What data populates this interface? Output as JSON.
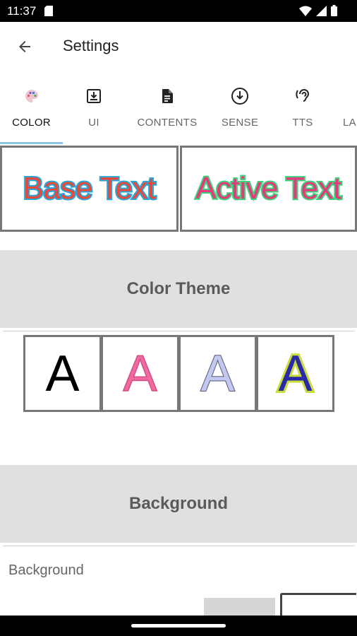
{
  "status_bar": {
    "time": "11:37"
  },
  "app_bar": {
    "title": "Settings",
    "back_icon": "arrow-back-icon"
  },
  "tabs": [
    {
      "label": "COLOR",
      "icon": "palette-icon",
      "active": true
    },
    {
      "label": "UI",
      "icon": "download-box-icon",
      "active": false
    },
    {
      "label": "CONTENTS",
      "icon": "document-icon",
      "active": false
    },
    {
      "label": "SENSE",
      "icon": "circle-arrow-down-icon",
      "active": false
    },
    {
      "label": "TTS",
      "icon": "ear-icon",
      "active": false
    },
    {
      "label": "LA",
      "icon": "",
      "active": false
    }
  ],
  "preview": {
    "base_text": "Base Text",
    "active_text": "Active Text"
  },
  "color_theme": {
    "header": "Color Theme",
    "letters": [
      "A",
      "A",
      "A",
      "A"
    ],
    "colors": [
      {
        "fill": "#000000",
        "stroke": "none"
      },
      {
        "fill": "#f06aa0",
        "stroke": "#d04f86"
      },
      {
        "fill": "#c3c8f0",
        "stroke": "#55596f"
      },
      {
        "fill": "#2a2aa8",
        "stroke": "#c8dc3c"
      }
    ]
  },
  "background": {
    "header": "Background",
    "label": "Background"
  }
}
